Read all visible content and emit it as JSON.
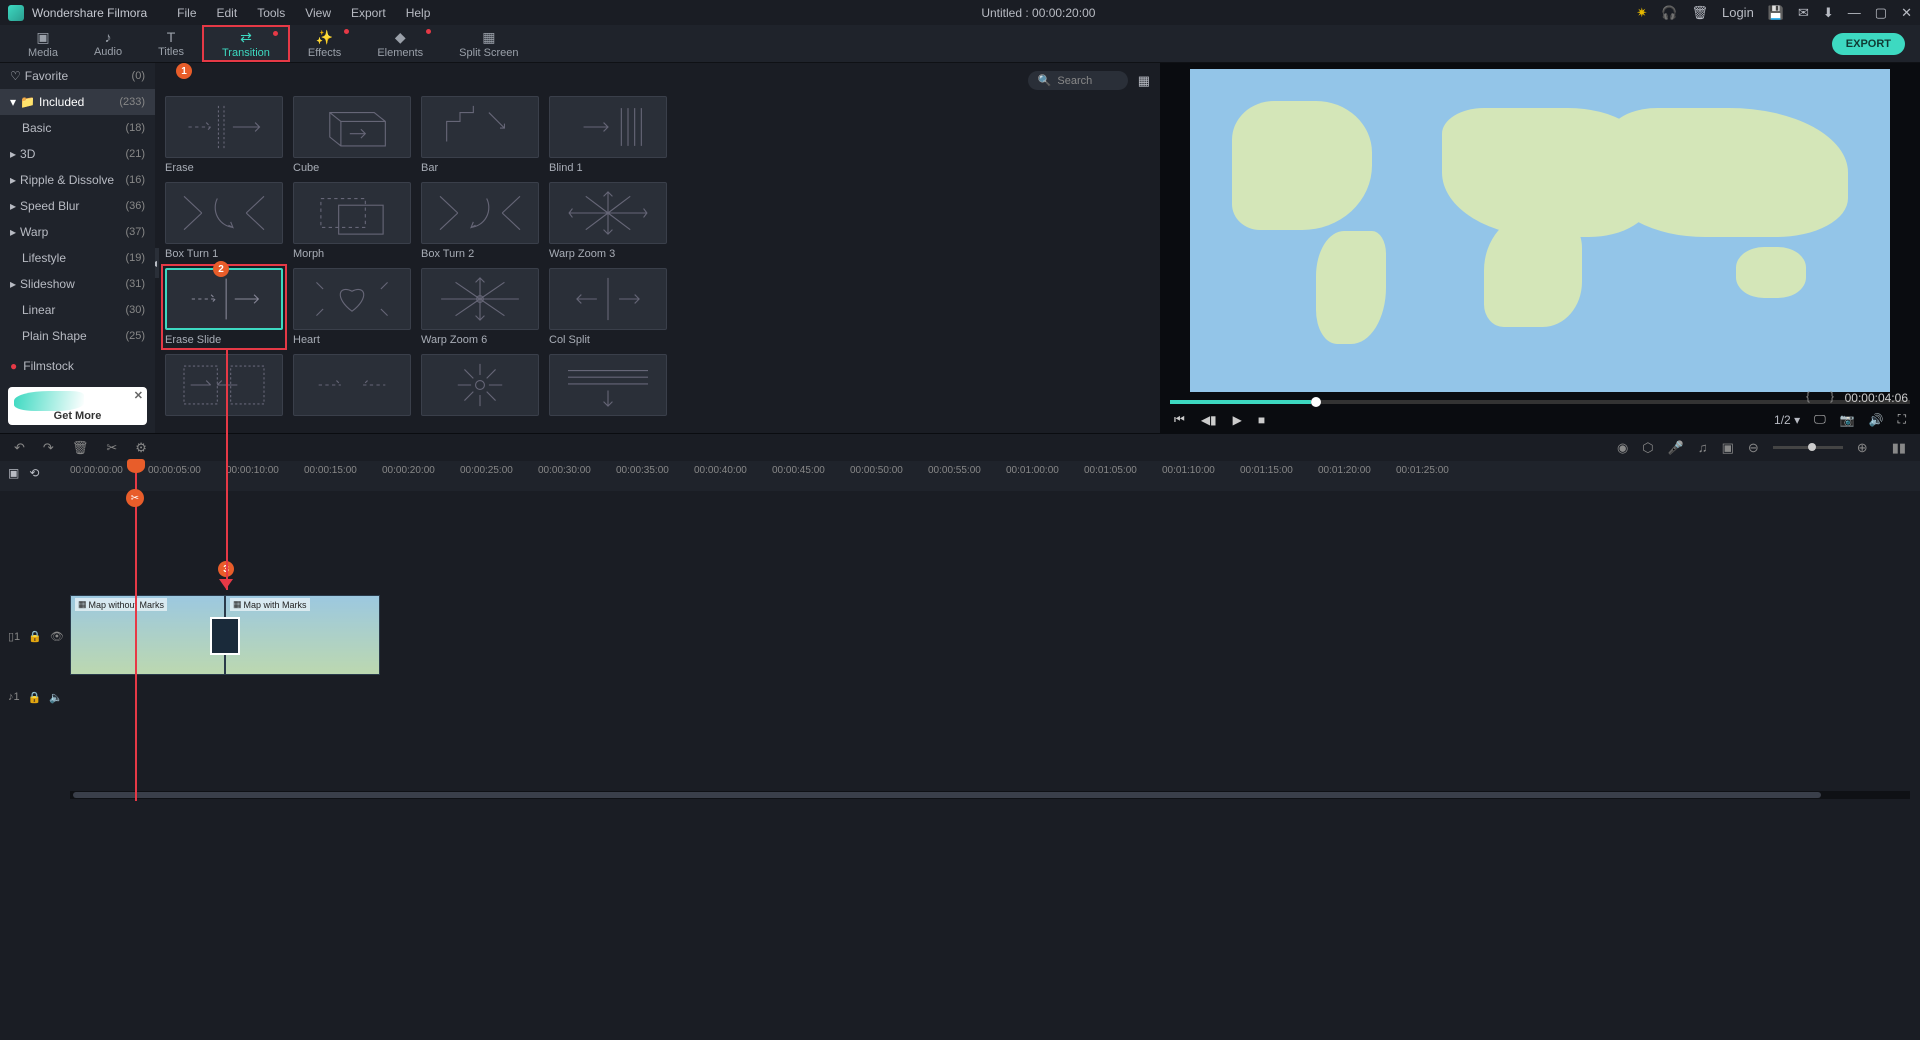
{
  "app": {
    "name": "Wondershare Filmora",
    "title": "Untitled : 00:00:20:00",
    "login": "Login"
  },
  "menu": [
    "File",
    "Edit",
    "Tools",
    "View",
    "Export",
    "Help"
  ],
  "tabs": [
    {
      "label": "Media"
    },
    {
      "label": "Audio"
    },
    {
      "label": "Titles"
    },
    {
      "label": "Transition",
      "active": true,
      "dot": true
    },
    {
      "label": "Effects",
      "dot": true
    },
    {
      "label": "Elements",
      "dot": true
    },
    {
      "label": "Split Screen"
    }
  ],
  "export": "EXPORT",
  "sidebar": {
    "favorite": {
      "label": "Favorite",
      "count": "(0)"
    },
    "included": {
      "label": "Included",
      "count": "(233)"
    },
    "items": [
      {
        "label": "Basic",
        "count": "(18)"
      },
      {
        "label": "3D",
        "count": "(21)",
        "caret": true
      },
      {
        "label": "Ripple & Dissolve",
        "count": "(16)",
        "caret": true
      },
      {
        "label": "Speed Blur",
        "count": "(36)",
        "caret": true
      },
      {
        "label": "Warp",
        "count": "(37)",
        "caret": true
      },
      {
        "label": "Lifestyle",
        "count": "(19)"
      },
      {
        "label": "Slideshow",
        "count": "(31)",
        "caret": true
      },
      {
        "label": "Linear",
        "count": "(30)"
      },
      {
        "label": "Plain Shape",
        "count": "(25)"
      }
    ],
    "filmstock": "Filmstock",
    "promo": "Get More"
  },
  "search": {
    "placeholder": "Search"
  },
  "transitions": {
    "row1": [
      "Erase",
      "Cube",
      "Bar",
      "Blind 1"
    ],
    "row2": [
      "Box Turn 1",
      "Morph",
      "Box Turn 2",
      "Warp Zoom 3"
    ],
    "row3": [
      "Erase Slide",
      "Heart",
      "Warp Zoom 6",
      "Col Split"
    ]
  },
  "preview": {
    "time": "00:00:04:06",
    "zoom": "1/2"
  },
  "ruler": {
    "ticks": [
      "00:00:00:00",
      "00:00:05:00",
      "00:00:10:00",
      "00:00:15:00",
      "00:00:20:00",
      "00:00:25:00",
      "00:00:30:00",
      "00:00:35:00",
      "00:00:40:00",
      "00:00:45:00",
      "00:00:50:00",
      "00:00:55:00",
      "00:01:00:00",
      "00:01:05:00",
      "00:01:10:00",
      "00:01:15:00",
      "00:01:20:00",
      "00:01:25:00"
    ]
  },
  "clips": {
    "clip1": "Map without Marks",
    "clip2": "Map with Marks"
  },
  "callouts": {
    "c1": "1",
    "c2": "2",
    "c3": "3"
  }
}
